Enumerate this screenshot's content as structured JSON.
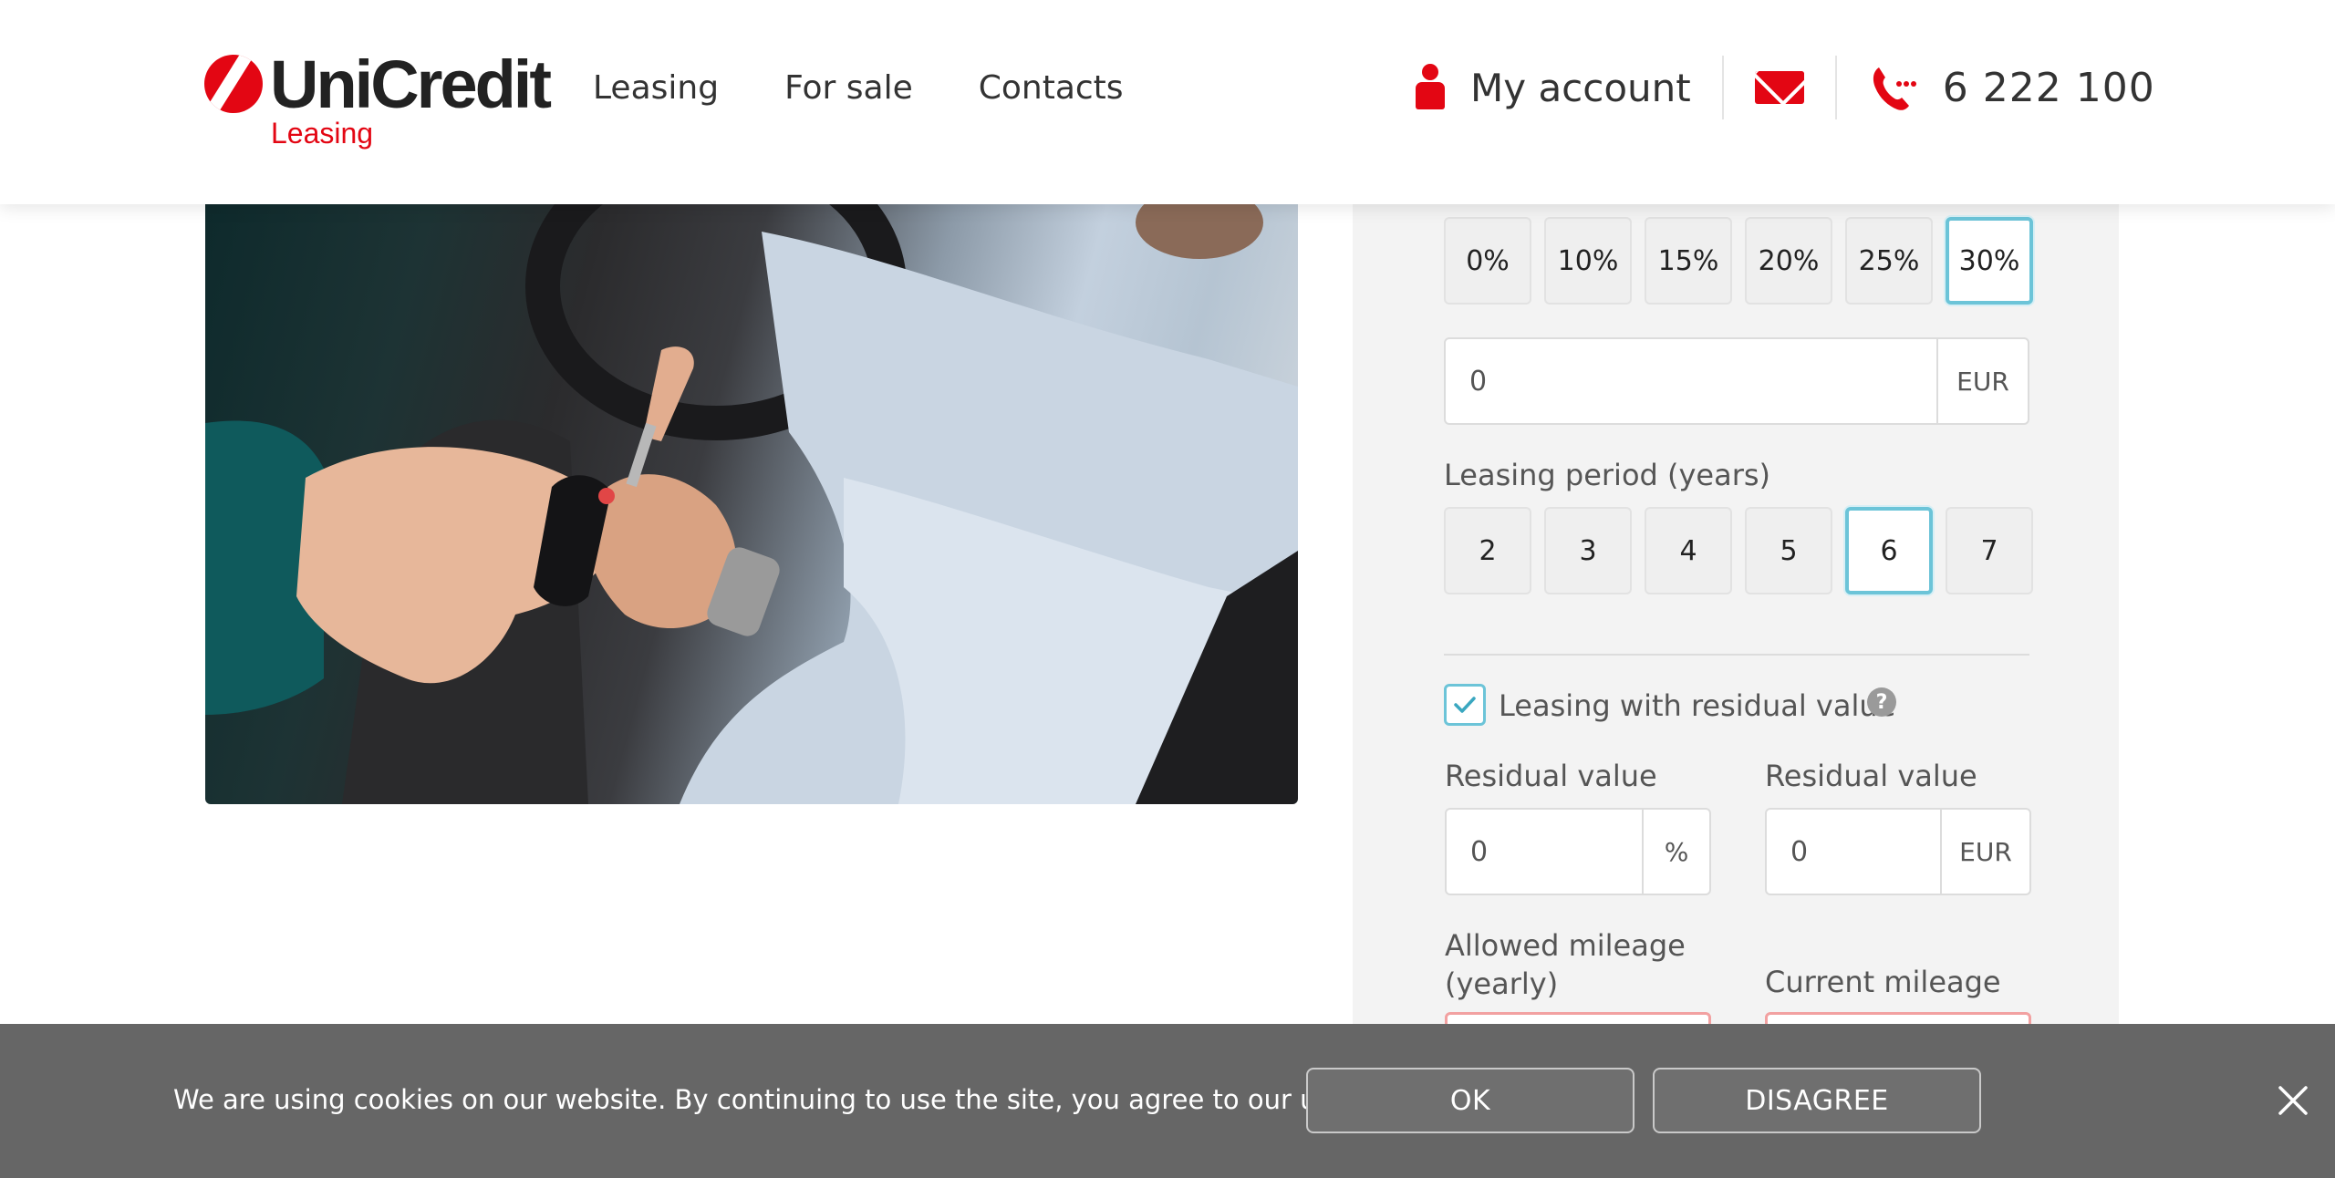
{
  "brand": {
    "name": "UniCredit",
    "sub": "Leasing",
    "color": "#e30613"
  },
  "nav": [
    {
      "label": "Leasing"
    },
    {
      "label": "For sale"
    },
    {
      "label": "Contacts"
    }
  ],
  "header": {
    "account_label": "My account",
    "phone": "6 222 100"
  },
  "calculator": {
    "down_payment_options": [
      "0%",
      "10%",
      "15%",
      "20%",
      "25%",
      "30%"
    ],
    "down_payment_selected": "30%",
    "down_payment_amount": {
      "value": "0",
      "unit": "EUR"
    },
    "period_label": "Leasing period (years)",
    "period_options": [
      "2",
      "3",
      "4",
      "5",
      "6",
      "7"
    ],
    "period_selected": "6",
    "residual_checkbox_label": "Leasing with residual value",
    "residual_checked": true,
    "residual_pct": {
      "label": "Residual value",
      "value": "0",
      "unit": "%"
    },
    "residual_eur": {
      "label": "Residual value",
      "value": "0",
      "unit": "EUR"
    },
    "allowed_mileage_label": "Allowed mileage (yearly)",
    "current_mileage_label": "Current mileage",
    "accent_color": "#6cc4d8"
  },
  "cookie": {
    "text": "We are using cookies on our website. By continuing to use the site, you agree to our use of cookies.",
    "ok_label": "OK",
    "disagree_label": "DISAGREE"
  }
}
